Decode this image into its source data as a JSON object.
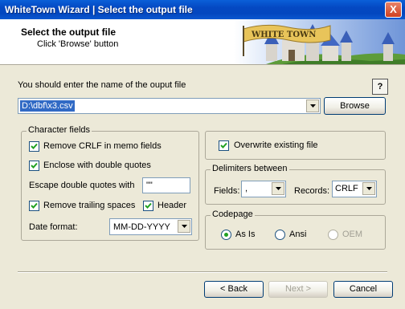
{
  "window": {
    "title": "WhiteTown Wizard | Select the output file",
    "close_glyph": "X"
  },
  "header": {
    "title": "Select the output file",
    "subtitle": "Click 'Browse' button",
    "logo_text": "WHITE TOWN"
  },
  "output": {
    "label": "You should enter the name of the ouput file",
    "path": "D:\\dbf\\x3.csv",
    "browse_label": "Browse",
    "help_label": "?"
  },
  "character_fields": {
    "legend": "Character fields",
    "remove_crlf": {
      "label": "Remove CRLF in memo fields",
      "checked": true
    },
    "enclose_quotes": {
      "label": "Enclose with double quotes",
      "checked": true
    },
    "escape_label": "Escape double quotes with",
    "escape_value": "\"\"",
    "remove_trailing": {
      "label": "Remove trailing spaces",
      "checked": true
    },
    "header": {
      "label": "Header",
      "checked": true
    },
    "date_format_label": "Date format:",
    "date_format_value": "MM-DD-YYYY"
  },
  "overwrite": {
    "label": "Overwrite existing file",
    "checked": true
  },
  "delimiters": {
    "legend": "Delimiters between",
    "fields_label": "Fields:",
    "fields_value": ",",
    "records_label": "Records:",
    "records_value": "CRLF"
  },
  "codepage": {
    "legend": "Codepage",
    "options": [
      {
        "label": "As Is",
        "selected": true,
        "enabled": true
      },
      {
        "label": "Ansi",
        "selected": false,
        "enabled": true
      },
      {
        "label": "OEM",
        "selected": false,
        "enabled": false
      }
    ]
  },
  "buttons": {
    "back": "< Back",
    "next": "Next >",
    "cancel": "Cancel"
  },
  "colors": {
    "titlebar": "#0448c2",
    "selection": "#316ac5",
    "radio_dot": "#21a121"
  }
}
